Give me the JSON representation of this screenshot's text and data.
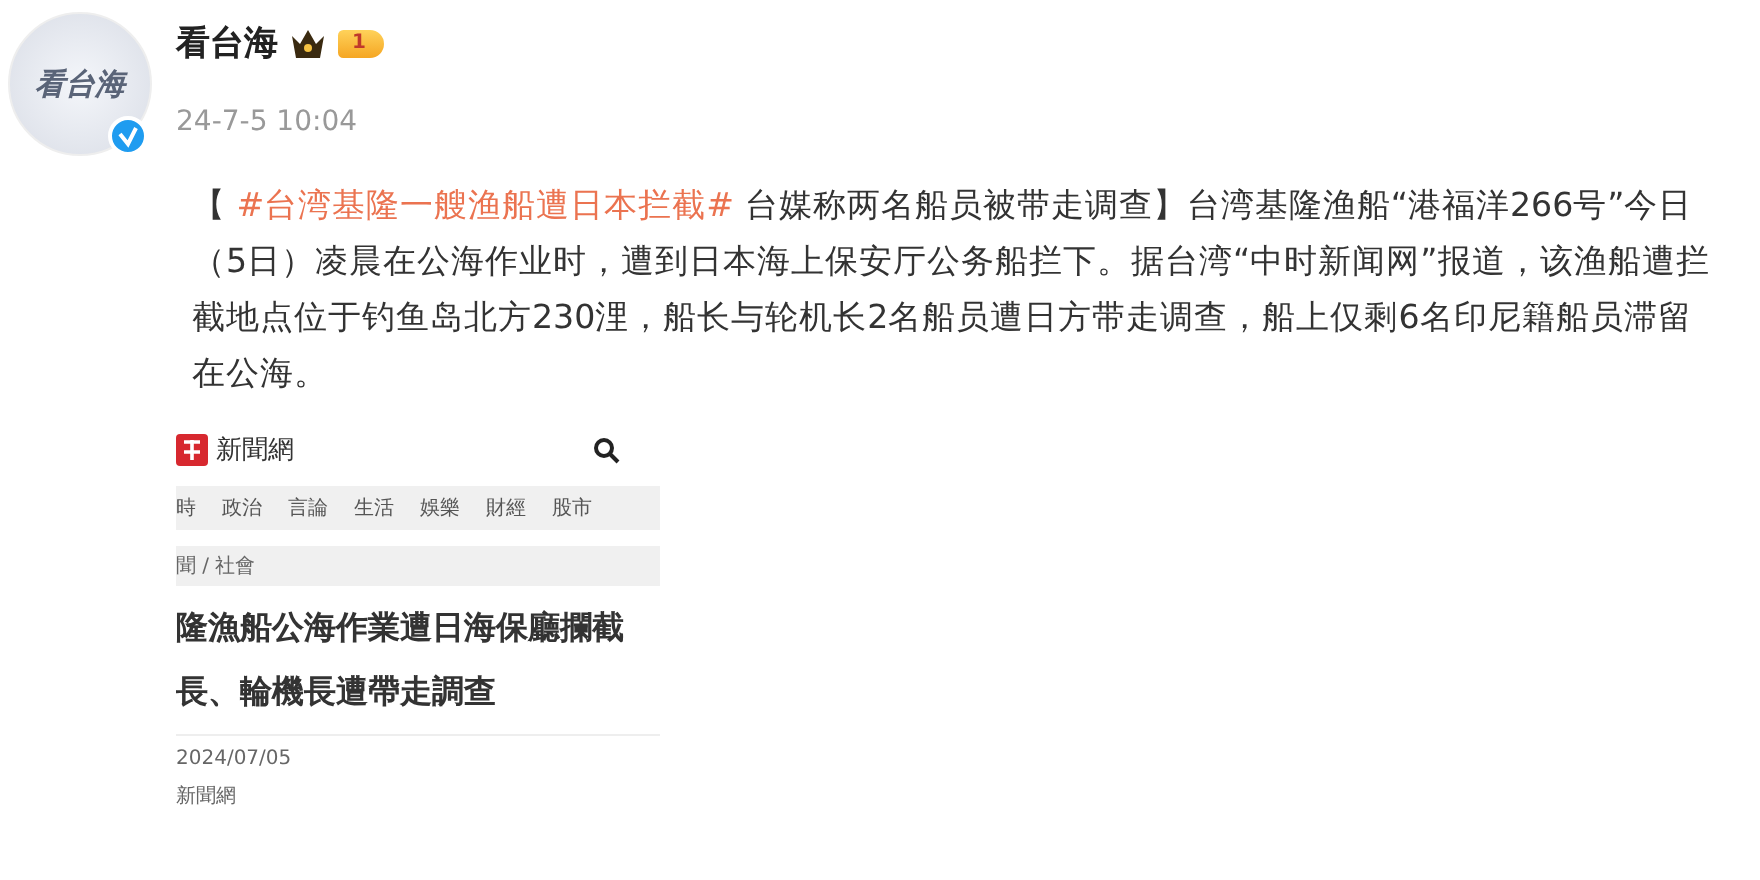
{
  "post": {
    "avatar_text": "看台海",
    "verified": true,
    "author": "看台海",
    "member_level": "1",
    "time": "24-7-5 10:04",
    "body": [
      {
        "kind": "text",
        "text": "【 "
      },
      {
        "kind": "topic",
        "text": "#台湾基隆一艘渔船遭日本拦截#"
      },
      {
        "kind": "text",
        "text": " 台媒称两名船员被带走调查】台湾基隆渔船“港福洋266号”今日（5日）凌晨在公海作业时，遭到日本海上保安厅公务船拦下。据台湾“中时新闻网”报道，该渔船遭拦截地点位于钓鱼岛北方230浬，船长与轮机长2名船员遭日方带走调查，船上仅剩6名印尼籍船员滞留在公海。"
      }
    ]
  },
  "embedded_page": {
    "site_name": "新聞網",
    "nav": [
      "時",
      "政治",
      "言論",
      "生活",
      "娛樂",
      "財經",
      "股市"
    ],
    "breadcrumb": "聞 / 社會",
    "headline": [
      "隆漁船公海作業遭日海保廳攔截",
      "長、輪機長遭帶走調查"
    ],
    "date": "2024/07/05",
    "source": "新聞網"
  }
}
